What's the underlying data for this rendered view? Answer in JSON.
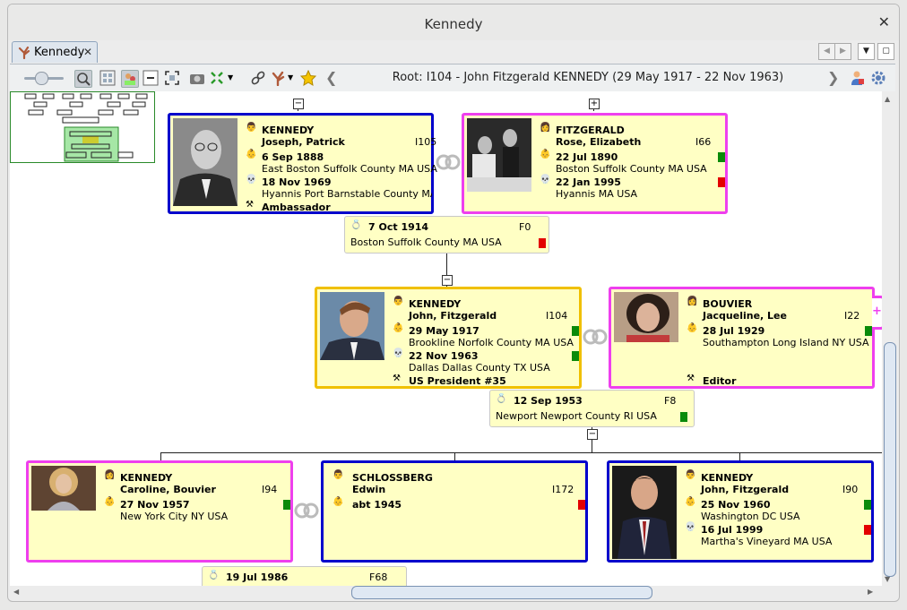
{
  "window": {
    "title": "Kennedy"
  },
  "tab": {
    "label": "Kennedy"
  },
  "toolbar": {
    "root_text": "Root: I104 - John Fitzgerald KENNEDY (29 May 1917 - 22 Nov 1963)"
  },
  "colors": {
    "male_border": "#0000cc",
    "female_border": "#ee3fee",
    "root_border": "#f0c000",
    "card_bg": "#ffffc4",
    "flag_ok": "#0a8a0a",
    "flag_missing": "#e30000"
  },
  "people": {
    "joseph": {
      "surname": "KENNEDY",
      "given": "Joseph, Patrick",
      "id": "I105",
      "birth_date": "6 Sep 1888",
      "birth_place": "East Boston Suffolk County MA USA",
      "death_date": "18 Nov 1969",
      "death_place": "Hyannis Port Barnstable County MA USA",
      "occupation": "Ambassador"
    },
    "rose": {
      "surname": "FITZGERALD",
      "given": "Rose, Elizabeth",
      "id": "I66",
      "birth_date": "22 Jul 1890",
      "birth_place": "Boston Suffolk County MA USA",
      "death_date": "22 Jan 1995",
      "death_place": "Hyannis MA USA"
    },
    "john": {
      "surname": "KENNEDY",
      "given": "John, Fitzgerald",
      "id": "I104",
      "birth_date": "29 May 1917",
      "birth_place": "Brookline Norfolk County MA USA",
      "death_date": "22 Nov 1963",
      "death_place": "Dallas Dallas County TX USA",
      "occupation": "US President #35"
    },
    "jacqueline": {
      "surname": "BOUVIER",
      "given": "Jacqueline, Lee",
      "id": "I22",
      "birth_date": "28 Jul 1929",
      "birth_place": "Southampton Long Island NY USA",
      "occupation": "Editor"
    },
    "caroline": {
      "surname": "KENNEDY",
      "given": "Caroline, Bouvier",
      "id": "I94",
      "birth_date": "27 Nov 1957",
      "birth_place": "New York City NY USA"
    },
    "edwin": {
      "surname": "SCHLOSSBERG",
      "given": "Edwin",
      "id": "I172",
      "birth_date": "abt 1945"
    },
    "johnjr": {
      "surname": "KENNEDY",
      "given": "John, Fitzgerald",
      "id": "I90",
      "birth_date": "25 Nov 1960",
      "birth_place": "Washington DC USA",
      "death_date": "16 Jul 1999",
      "death_place": "Martha's Vineyard MA USA"
    }
  },
  "families": {
    "f0": {
      "date": "7 Oct 1914",
      "id": "F0",
      "place": "Boston Suffolk County MA USA"
    },
    "f8": {
      "date": "12 Sep 1953",
      "id": "F8",
      "place": "Newport Newport County RI USA"
    },
    "f68": {
      "date": "19 Jul 1986",
      "id": "F68"
    }
  }
}
